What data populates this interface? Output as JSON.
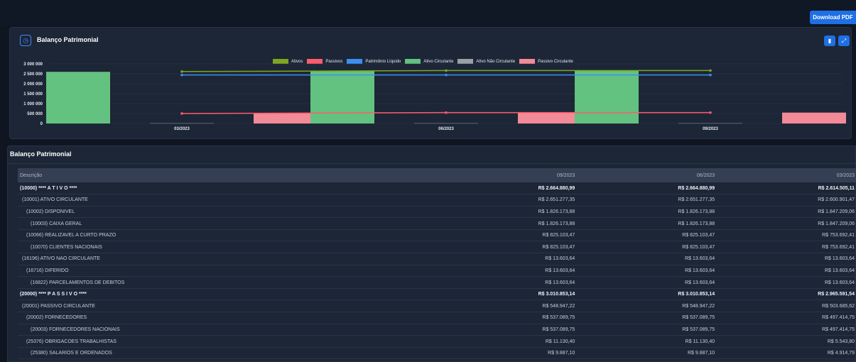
{
  "header": {
    "download_label": "Download PDF"
  },
  "chart_card": {
    "title": "Balanço Patrimonial",
    "icons": [
      "clock-icon",
      "pdf-icon",
      "expand-icon"
    ]
  },
  "chart_data": {
    "type": "bar",
    "categories": [
      "03/2023",
      "06/2023",
      "09/2023"
    ],
    "ylim": [
      0,
      3000000
    ],
    "yticks": [
      "3 000 000",
      "2 500 000",
      "2 000 000",
      "1 500 000",
      "1 000 000",
      "500 000",
      "0"
    ],
    "series": [
      {
        "name": "Ativos",
        "kind": "line",
        "color": "#7ea71f",
        "values": [
          2614505.11,
          2664880.99,
          2664880.99
        ]
      },
      {
        "name": "Passivos",
        "kind": "line",
        "color": "#ff5b6b",
        "values": [
          503685.62,
          548947.22,
          548947.22
        ]
      },
      {
        "name": "Patrimônio Líquido",
        "kind": "line",
        "color": "#3b8ff1",
        "values": [
          2440000,
          2440000,
          2440000
        ]
      },
      {
        "name": "Ativo Circulante",
        "kind": "bar",
        "color": "#63c27f",
        "values": [
          2600901.47,
          2651277.35,
          2651277.35
        ]
      },
      {
        "name": "Ativo Não Circulante",
        "kind": "bar",
        "color": "#9aa0a6",
        "values": [
          13603.64,
          13603.64,
          13603.64
        ]
      },
      {
        "name": "Passivo Circulante",
        "kind": "bar",
        "color": "#f28a98",
        "values": [
          503685.62,
          548947.22,
          548947.22
        ]
      }
    ],
    "grid": true,
    "legend": "top-center"
  },
  "table_card": {
    "title": "Balanço Patrimonial",
    "columns": [
      "Descrição",
      "09/2023",
      "06/2023",
      "03/2023"
    ],
    "rows": [
      {
        "indent": 0,
        "bold": true,
        "cells": [
          "(10000) **** A T I V O ****",
          "R$ 2.664.880,99",
          "R$ 2.664.880,99",
          "R$ 2.614.505,11"
        ]
      },
      {
        "indent": 1,
        "bold": false,
        "cells": [
          "(10001) ATIVO CIRCULANTE",
          "R$ 2.651.277,35",
          "R$ 2.651.277,35",
          "R$ 2.600.901,47"
        ]
      },
      {
        "indent": 2,
        "bold": false,
        "cells": [
          "(10002) DISPONIVEL",
          "R$ 1.826.173,88",
          "R$ 1.826.173,88",
          "R$ 1.847.209,06"
        ]
      },
      {
        "indent": 3,
        "bold": false,
        "cells": [
          "(10003) CAIXA GERAL",
          "R$ 1.826.173,88",
          "R$ 1.826.173,88",
          "R$ 1.847.209,06"
        ]
      },
      {
        "indent": 2,
        "bold": false,
        "cells": [
          "(10066) REALIZAVEL A CURTO PRAZO",
          "R$ 825.103,47",
          "R$ 825.103,47",
          "R$ 753.692,41"
        ]
      },
      {
        "indent": 3,
        "bold": false,
        "cells": [
          "(10070) CLIENTES NACIONAIS",
          "R$ 825.103,47",
          "R$ 825.103,47",
          "R$ 753.692,41"
        ]
      },
      {
        "indent": 1,
        "bold": false,
        "cells": [
          "(16196) ATIVO NAO CIRCULANTE",
          "R$ 13.603,64",
          "R$ 13.603,64",
          "R$ 13.603,64"
        ]
      },
      {
        "indent": 2,
        "bold": false,
        "cells": [
          "(16716) DIFERIDO",
          "R$ 13.603,64",
          "R$ 13.603,64",
          "R$ 13.603,64"
        ]
      },
      {
        "indent": 3,
        "bold": false,
        "cells": [
          "(16822) PARCELAMENTOS DE DEBITOS",
          "R$ 13.603,64",
          "R$ 13.603,64",
          "R$ 13.603,64"
        ]
      },
      {
        "indent": 0,
        "bold": true,
        "cells": [
          "(20000) **** P A S S I V O ****",
          "R$ 3.010.853,14",
          "R$ 3.010.853,14",
          "R$ 2.965.591,54"
        ]
      },
      {
        "indent": 1,
        "bold": false,
        "cells": [
          "(20001) PASSIVO CIRCULANTE",
          "R$ 548.947,22",
          "R$ 548.947,22",
          "R$ 503.685,62"
        ]
      },
      {
        "indent": 2,
        "bold": false,
        "cells": [
          "(20002) FORNECEDORES",
          "R$ 537.089,75",
          "R$ 537.089,75",
          "R$ 497.414,75"
        ]
      },
      {
        "indent": 3,
        "bold": false,
        "cells": [
          "(20003) FORNECEDORES NACIONAIS",
          "R$ 537.089,75",
          "R$ 537.089,75",
          "R$ 497.414,75"
        ]
      },
      {
        "indent": 2,
        "bold": false,
        "cells": [
          "(25376) OBRIGACOES TRABALHISTAS",
          "R$ 11.130,40",
          "R$ 11.130,40",
          "R$ 5.543,80"
        ]
      },
      {
        "indent": 3,
        "bold": false,
        "cells": [
          "(25380) SALARIOS E ORDENADOS",
          "R$ 9.887,10",
          "R$ 9.887,10",
          "R$ 4.914,79"
        ]
      }
    ]
  }
}
